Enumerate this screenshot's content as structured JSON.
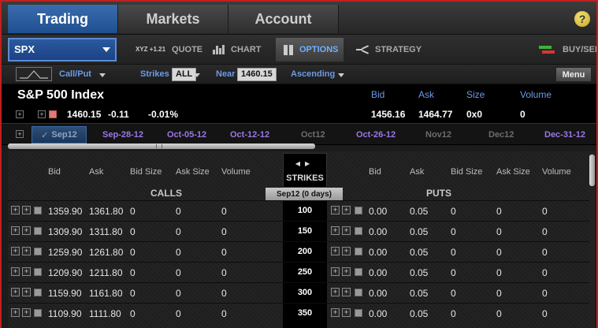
{
  "nav": {
    "tabs": [
      {
        "label": "Trading",
        "active": true
      },
      {
        "label": "Markets",
        "active": false
      },
      {
        "label": "Account",
        "active": false
      }
    ],
    "help_label": "?"
  },
  "toolbar": {
    "symbol": "SPX",
    "quote_icon_text": "XYZ +1.21",
    "quote_label": "QUOTE",
    "chart_label": "CHART",
    "options_label": "OPTIONS",
    "strategy_label": "STRATEGY",
    "buysell_label": "BUY/SELL"
  },
  "filters": {
    "callput_label": "Call/Put",
    "strikes_label": "Strikes",
    "strikes_value": "ALL",
    "near_label": "Near",
    "near_value": "1460.15",
    "sort_label": "Ascending",
    "menu_label": "Menu"
  },
  "quote": {
    "name": "S&P 500 Index",
    "last": "1460.15",
    "change": "-0.11",
    "change_pct": "-0.01%",
    "headers": {
      "bid": "Bid",
      "ask": "Ask",
      "size": "Size",
      "volume": "Volume"
    },
    "bid": "1456.16",
    "ask": "1464.77",
    "size": "0x0",
    "volume": "0"
  },
  "expirations": {
    "active": "Sep12",
    "items": [
      {
        "label": "Sep-28-12",
        "dim": false
      },
      {
        "label": "Oct-05-12",
        "dim": false
      },
      {
        "label": "Oct-12-12",
        "dim": false
      },
      {
        "label": "Oct12",
        "dim": true
      },
      {
        "label": "Oct-26-12",
        "dim": false
      },
      {
        "label": "Nov12",
        "dim": true
      },
      {
        "label": "Dec12",
        "dim": true
      },
      {
        "label": "Dec-31-12",
        "dim": false
      }
    ]
  },
  "table": {
    "columns": {
      "bid": "Bid",
      "ask": "Ask",
      "bid_size": "Bid Size",
      "ask_size": "Ask Size",
      "volume": "Volume"
    },
    "calls_label": "CALLS",
    "puts_label": "PUTS",
    "strikes_label": "STRIKES",
    "expiry_label": "Sep12   (0 days)",
    "rows": [
      {
        "strike": "100",
        "call": {
          "bid": "1359.90",
          "ask": "1361.80",
          "bid_size": "0",
          "ask_size": "0",
          "volume": "0"
        },
        "put": {
          "bid": "0.00",
          "ask": "0.05",
          "bid_size": "0",
          "ask_size": "0",
          "volume": "0"
        }
      },
      {
        "strike": "150",
        "call": {
          "bid": "1309.90",
          "ask": "1311.80",
          "bid_size": "0",
          "ask_size": "0",
          "volume": "0"
        },
        "put": {
          "bid": "0.00",
          "ask": "0.05",
          "bid_size": "0",
          "ask_size": "0",
          "volume": "0"
        }
      },
      {
        "strike": "200",
        "call": {
          "bid": "1259.90",
          "ask": "1261.80",
          "bid_size": "0",
          "ask_size": "0",
          "volume": "0"
        },
        "put": {
          "bid": "0.00",
          "ask": "0.05",
          "bid_size": "0",
          "ask_size": "0",
          "volume": "0"
        }
      },
      {
        "strike": "250",
        "call": {
          "bid": "1209.90",
          "ask": "1211.80",
          "bid_size": "0",
          "ask_size": "0",
          "volume": "0"
        },
        "put": {
          "bid": "0.00",
          "ask": "0.05",
          "bid_size": "0",
          "ask_size": "0",
          "volume": "0"
        }
      },
      {
        "strike": "300",
        "call": {
          "bid": "1159.90",
          "ask": "1161.80",
          "bid_size": "0",
          "ask_size": "0",
          "volume": "0"
        },
        "put": {
          "bid": "0.00",
          "ask": "0.05",
          "bid_size": "0",
          "ask_size": "0",
          "volume": "0"
        }
      },
      {
        "strike": "350",
        "call": {
          "bid": "1109.90",
          "ask": "1111.80",
          "bid_size": "0",
          "ask_size": "0",
          "volume": "0"
        },
        "put": {
          "bid": "0.00",
          "ask": "0.05",
          "bid_size": "0",
          "ask_size": "0",
          "volume": "0"
        }
      }
    ]
  }
}
